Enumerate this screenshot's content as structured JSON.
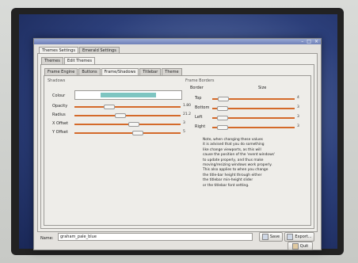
{
  "main_tabs": [
    "Themes Settings",
    "Emerald Settings"
  ],
  "sub_tabs": [
    "Themes",
    "Edit Themes"
  ],
  "edit_tabs": [
    "Frame Engine",
    "Buttons",
    "Frame/Shadows",
    "Titlebar",
    "Theme"
  ],
  "shadows": {
    "title": "Shadows",
    "colour_label": "Colour",
    "colour_value": "#7ec5c1",
    "sliders": [
      {
        "label": "Opacity",
        "value": "1.80",
        "fraction": 0.3
      },
      {
        "label": "Radius",
        "value": "21.2",
        "fraction": 0.42
      },
      {
        "label": "X Offset",
        "value": "3",
        "fraction": 0.56
      },
      {
        "label": "Y Offset",
        "value": "5",
        "fraction": 0.6
      }
    ]
  },
  "frame_borders": {
    "title": "Frame Borders",
    "col_border": "Border",
    "col_size": "Size",
    "sliders": [
      {
        "label": "Top",
        "value": "4",
        "fraction": 0.08
      },
      {
        "label": "Bottom",
        "value": "3",
        "fraction": 0.06
      },
      {
        "label": "Left",
        "value": "3",
        "fraction": 0.06
      },
      {
        "label": "Right",
        "value": "3",
        "fraction": 0.06
      }
    ],
    "note": "Note, when changing these values\nit is advised that you do something\nlike change viewports, as this will\ncause the position of the 'event windows'\nto update properly, and thus make\nmoving/resizing windows work properly.\nThis also applies to when you change\nthe title-bar height through either\nthe titlebar min-height slider\nor the titlebar font setting."
  },
  "footer": {
    "name_label": "Name:",
    "name_value": "graham_pale_blue",
    "save_label": "Save",
    "export_label": "Export...",
    "quit_label": "Quit"
  },
  "window_buttons": [
    "–",
    "□",
    "×"
  ]
}
